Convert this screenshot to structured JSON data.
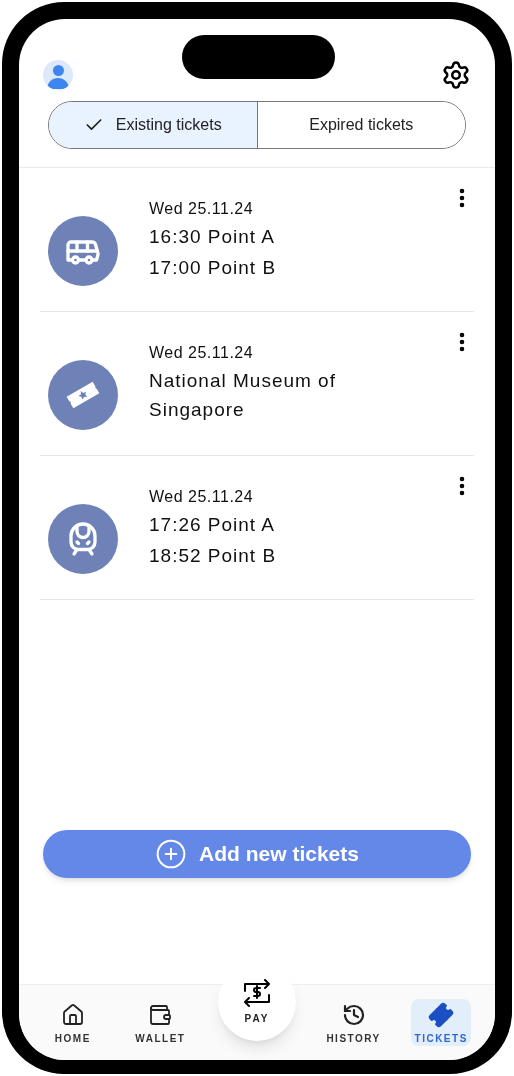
{
  "tabs": [
    {
      "label": "Existing tickets",
      "selected": true
    },
    {
      "label": "Expired tickets",
      "selected": false
    }
  ],
  "tickets": [
    {
      "kind": "bus",
      "date": "Wed 25.11.24",
      "lines": [
        "16:30 Point A",
        "17:00 Point B"
      ]
    },
    {
      "kind": "museum",
      "date": "Wed 25.11.24",
      "lines": [
        "National Museum of Singapore"
      ]
    },
    {
      "kind": "train",
      "date": "Wed 25.11.24",
      "lines": [
        "17:26 Point A",
        "18:52 Point B"
      ]
    }
  ],
  "add_button": {
    "label": "Add new tickets"
  },
  "nav": [
    {
      "kind": "home",
      "label": "HOME",
      "selected": false
    },
    {
      "kind": "wallet",
      "label": "WALLET",
      "selected": false
    },
    {
      "kind": "pay",
      "label": "PAY",
      "selected": false
    },
    {
      "kind": "history",
      "label": "HISTORY",
      "selected": false
    },
    {
      "kind": "tickets",
      "label": "TICKETS",
      "selected": true
    }
  ]
}
